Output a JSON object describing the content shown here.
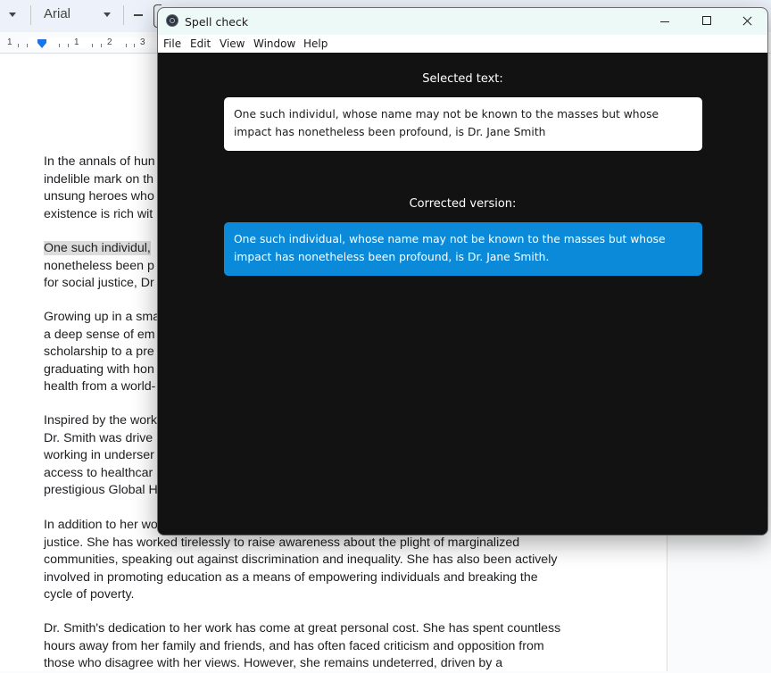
{
  "docs": {
    "toolbar": {
      "font_name": "Arial"
    },
    "ruler": {
      "numbers": [
        "1",
        "1",
        "2",
        "3"
      ]
    },
    "paragraphs": [
      {
        "lines": [
          "In the annals of hun",
          "indelible mark on th",
          "unsung heroes who",
          "existence is rich wit"
        ]
      },
      {
        "lines": [
          "One such individul,",
          "nonetheless been p",
          "for social justice, Dr"
        ],
        "highlight_first": true
      },
      {
        "lines": [
          "Growing up in a sma",
          "a deep sense of em",
          "scholarship to a pre",
          "graduating with hon",
          "health from a world-"
        ]
      },
      {
        "lines": [
          "Inspired by the work",
          "Dr. Smith was drive",
          "working in underser",
          "access to healthcar",
          "prestigious Global H"
        ]
      },
      {
        "lines": [
          "In addition to her wo",
          "justice. She has worked tirelessly to raise awareness about the plight of marginalized",
          "communities, speaking out against discrimination and inequality. She has also been actively",
          "involved in promoting education as a means of empowering individuals and breaking the",
          "cycle of poverty."
        ]
      },
      {
        "lines": [
          "Dr. Smith's dedication to her work has come at great personal cost. She has spent countless",
          "hours away from her family and friends, and has often faced criticism and opposition from",
          "those who disagree with her views. However, she remains undeterred, driven by a"
        ]
      }
    ]
  },
  "window": {
    "title": "Spell check",
    "app_icon": "electron-icon",
    "controls": [
      "minimize-icon",
      "maximize-icon",
      "close-icon"
    ],
    "menu": [
      "File",
      "Edit",
      "View",
      "Window",
      "Help"
    ],
    "selected_label": "Selected text:",
    "selected_text": "One such individul, whose name may not be known to the masses but whose impact has nonetheless been profound, is Dr. Jane Smith",
    "corrected_label": "Corrected version:",
    "corrected_text": "One such individual, whose name may not be known to the masses but whose impact has nonetheless been profound, is Dr. Jane Smith.",
    "colors": {
      "background": "#121212",
      "corrected_card": "#0a8ad8",
      "selected_card": "#ffffff",
      "titlebar": "#edf9f7"
    }
  }
}
